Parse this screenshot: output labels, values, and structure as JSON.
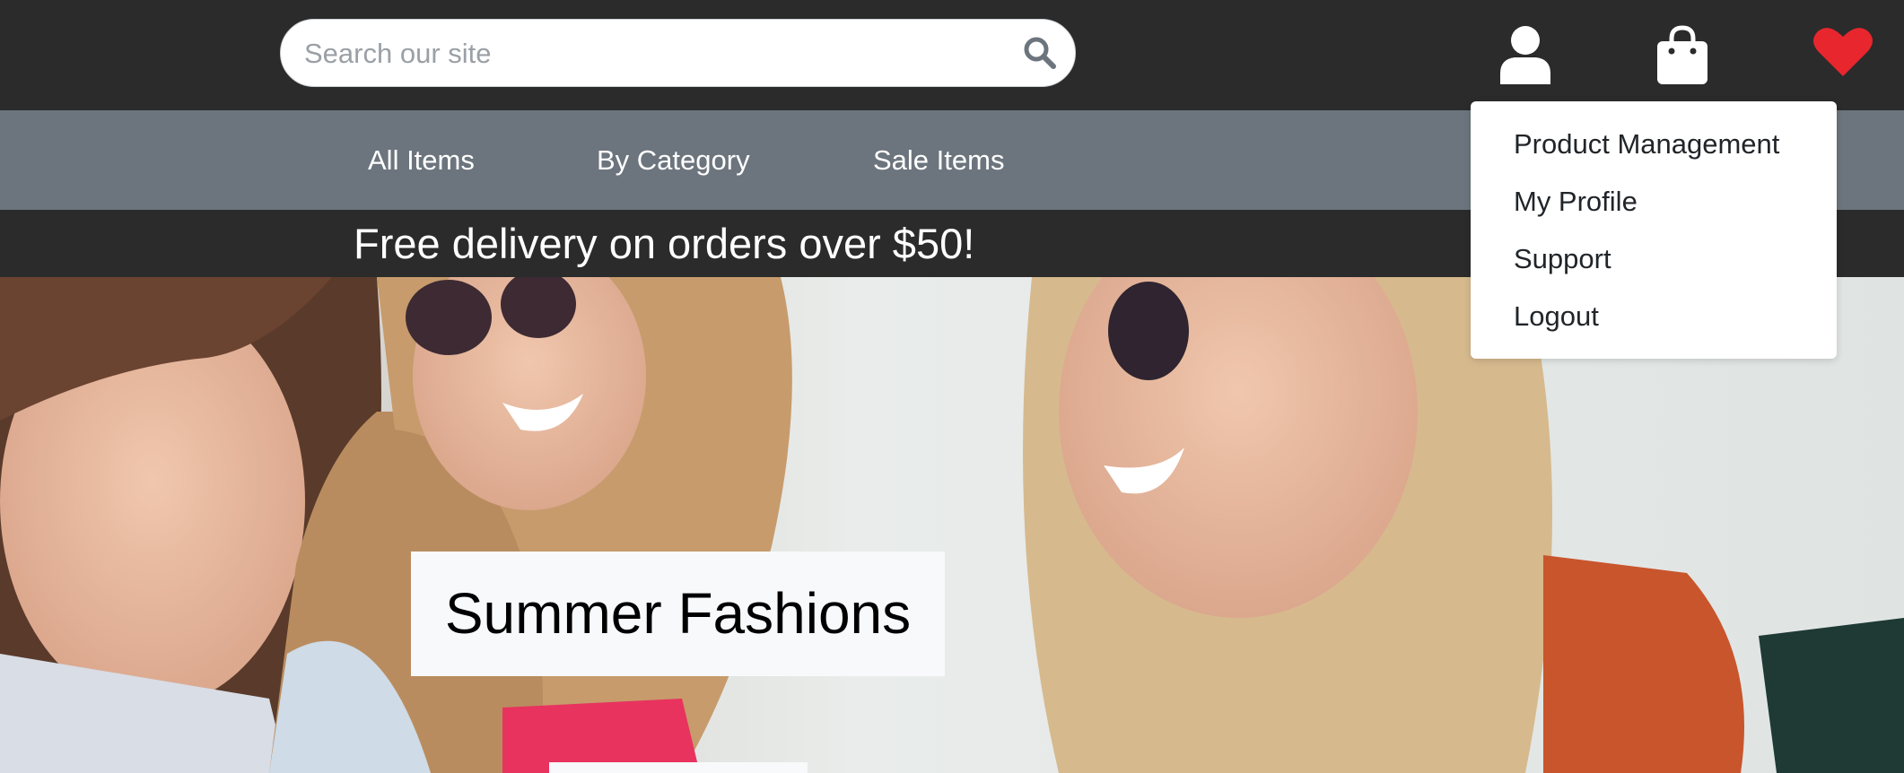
{
  "header": {
    "search": {
      "placeholder": "Search our site",
      "value": ""
    },
    "icons": [
      "search-icon",
      "user-icon",
      "shopping-bag-icon",
      "heart-icon"
    ],
    "accent_heart": "#e8262e"
  },
  "nav": {
    "items": [
      "All Items",
      "By Category",
      "Sale Items"
    ]
  },
  "promo": {
    "text": "Free delivery on orders over $50!"
  },
  "hero": {
    "title": "Summer Fashions"
  },
  "account_menu": {
    "items": [
      "Product Management",
      "My Profile",
      "Support",
      "Logout"
    ]
  },
  "colors": {
    "top_bar": "#2b2b2b",
    "nav_bar": "#6c757d",
    "promo_bar": "#2b2b2b",
    "hero_box": "#f8f9fa"
  }
}
